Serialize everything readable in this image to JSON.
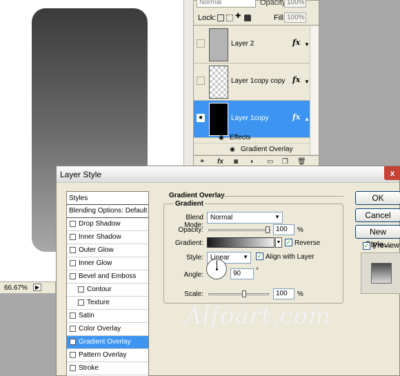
{
  "canvas": {
    "zoom": "66.67%"
  },
  "layers_panel": {
    "blend_mode": "Normal",
    "opacity_label": "Opacity:",
    "opacity_value": "100%",
    "lock_label": "Lock:",
    "fill_label": "Fill:",
    "fill_value": "100%",
    "layers": [
      {
        "name": "Layer 2",
        "fx": "fx"
      },
      {
        "name": "Layer 1copy copy",
        "fx": "fx"
      },
      {
        "name": "Layer 1copy",
        "fx": "fx"
      }
    ],
    "effects_label": "Effects",
    "effect_item": "Gradient Overlay"
  },
  "dialog": {
    "title": "Layer Style",
    "close": "x",
    "styles_header": "Styles",
    "blending_options": "Blending Options: Default",
    "styles": [
      {
        "label": "Drop Shadow",
        "checked": false
      },
      {
        "label": "Inner Shadow",
        "checked": false
      },
      {
        "label": "Outer Glow",
        "checked": false
      },
      {
        "label": "Inner Glow",
        "checked": false
      },
      {
        "label": "Bevel and Emboss",
        "checked": false
      },
      {
        "label": "Contour",
        "checked": false
      },
      {
        "label": "Texture",
        "checked": false
      },
      {
        "label": "Satin",
        "checked": false
      },
      {
        "label": "Color Overlay",
        "checked": false
      },
      {
        "label": "Gradient Overlay",
        "checked": true
      },
      {
        "label": "Pattern Overlay",
        "checked": false
      },
      {
        "label": "Stroke",
        "checked": false
      }
    ],
    "section_title": "Gradient Overlay",
    "group_title": "Gradient",
    "blend_mode_label": "Blend Mode:",
    "blend_mode_value": "Normal",
    "opacity_label": "Opacity:",
    "opacity_value": "100",
    "percent": "%",
    "gradient_label": "Gradient:",
    "reverse_label": "Reverse",
    "reverse_checked": true,
    "style_label": "Style:",
    "style_value": "Linear",
    "align_label": "Align with Layer",
    "align_checked": true,
    "angle_label": "Angle:",
    "angle_value": "90",
    "degree": "°",
    "scale_label": "Scale:",
    "scale_value": "100",
    "ok": "OK",
    "cancel": "Cancel",
    "new_style": "New Style...",
    "preview_label": "Preview",
    "preview_checked": true
  },
  "watermark": "Alfoart.com"
}
